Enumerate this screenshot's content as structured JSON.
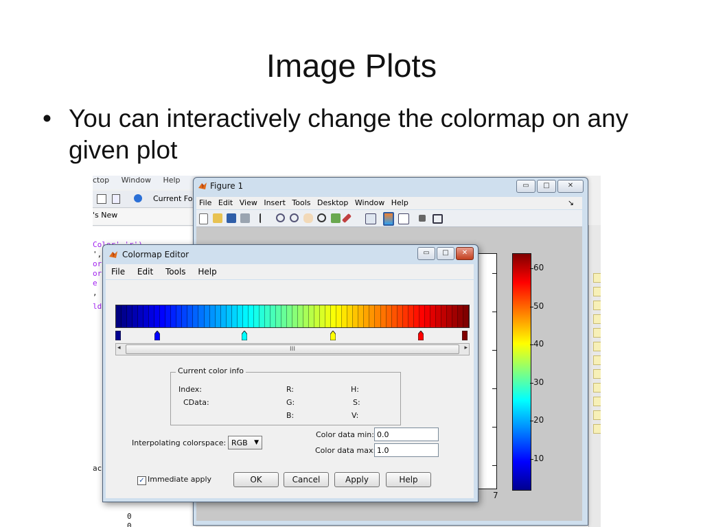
{
  "slide": {
    "title": "Image Plots",
    "bullet": "You can interactively change the colormap on any given plot",
    "bullet_symbol": "•"
  },
  "desktop": {
    "menu": [
      "ctop",
      "Window",
      "Help"
    ],
    "toolbar_label": "Current Fo",
    "tab_label": "'s New",
    "code_lines": [
      "Color','r')",
      "',",
      "or",
      "or",
      "e",
      ", (",
      "",
      "ld",
      "",
      "",
      "",
      "",
      "",
      "",
      "",
      "",
      "",
      "",
      "",
      "",
      "",
      "",
      "ac"
    ],
    "bottom_numbers": [
      "0",
      "0"
    ]
  },
  "figure": {
    "title": "Figure 1",
    "menu": [
      "File",
      "Edit",
      "View",
      "Insert",
      "Tools",
      "Desktop",
      "Window",
      "Help"
    ],
    "menu_end_glyph": "↘",
    "x_tick_label": "7",
    "colorbar_labels": [
      "60",
      "50",
      "40",
      "30",
      "20",
      "10"
    ]
  },
  "colormap_editor": {
    "title": "Colormap Editor",
    "menu": [
      "File",
      "Edit",
      "Tools",
      "Help"
    ],
    "scroll_grip": "III",
    "current_color_info": "Current color info",
    "labels": {
      "index": "Index:",
      "cdata": "CData:",
      "r": "R:",
      "g": "G:",
      "b": "B:",
      "h": "H:",
      "s": "S:",
      "v": "V:"
    },
    "interpolating_label": "Interpolating colorspace:",
    "interpolating_value": "RGB",
    "color_min_label": "Color data min:",
    "color_min_value": "0.0",
    "color_max_label": "Color data max:",
    "color_max_value": "1.0",
    "immediate_apply_label": "Immediate apply",
    "immediate_apply_checked": true,
    "buttons": {
      "ok": "OK",
      "cancel": "Cancel",
      "apply": "Apply",
      "help": "Help"
    },
    "colormap": "jet"
  },
  "colors": {
    "window_frame": "#cfdfee",
    "close_button": "#c3401f",
    "code_keyword": "#a020f0"
  }
}
